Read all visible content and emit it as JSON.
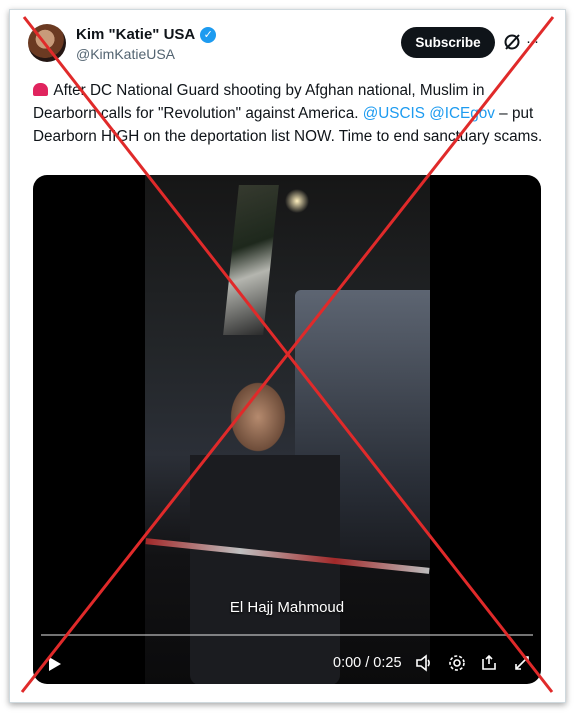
{
  "author": {
    "display_name": "Kim \"Katie\" USA",
    "verified": true,
    "handle": "@KimKatieUSA"
  },
  "actions": {
    "subscribe_label": "Subscribe",
    "grok_icon": "grok-icon",
    "more_icon": "more-icon"
  },
  "tweet": {
    "text_part1": " After DC National Guard shooting by Afghan national, Muslim in Dearborn calls for \"Revolution\" against America.  ",
    "mention1": "@USCIS",
    "mention2": "@ICEgov",
    "text_part2": " – put Dearborn HIGH on the deportation list NOW.  Time to end sanctuary scams."
  },
  "video": {
    "caption": "El Hajj Mahmoud",
    "timecode": "0:00 / 0:25",
    "progress": 0
  },
  "colors": {
    "accent": "#1d9bf0",
    "overlay_cross": "#e02a2a"
  }
}
